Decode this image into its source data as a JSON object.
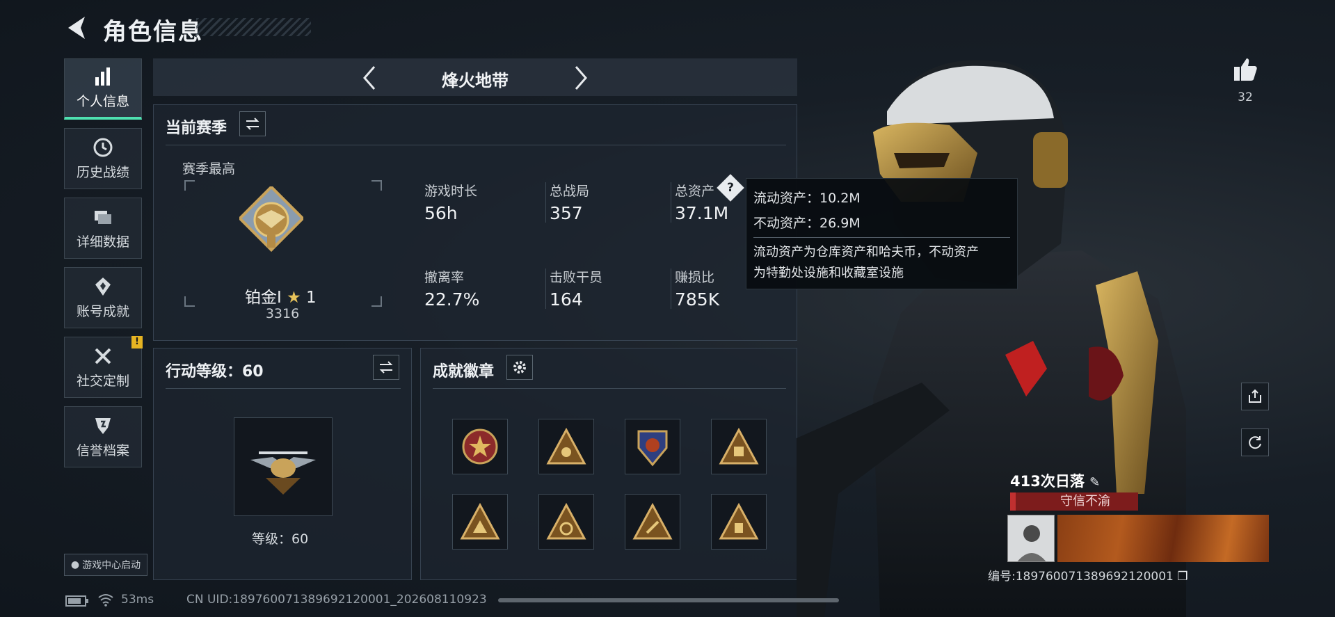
{
  "header": {
    "title": "角色信息"
  },
  "sidebar": {
    "items": [
      {
        "label": "个人信息",
        "icon": "bar-chart-icon",
        "active": true
      },
      {
        "label": "历史战绩",
        "icon": "clock-icon",
        "active": false
      },
      {
        "label": "详细数据",
        "icon": "folder-icon",
        "active": false
      },
      {
        "label": "账号成就",
        "icon": "medal-icon",
        "active": false
      },
      {
        "label": "社交定制",
        "icon": "tools-icon",
        "active": false,
        "badge": "!"
      },
      {
        "label": "信誉档案",
        "icon": "shield-icon",
        "active": false
      }
    ],
    "launch_label": "游戏中心启动"
  },
  "season_nav": {
    "title": "烽火地带"
  },
  "current_season": {
    "title": "当前赛季",
    "best_label": "赛季最高",
    "rank_name": "铂金Ⅰ",
    "rank_stars": "1",
    "rank_score": "3316",
    "stats": [
      {
        "label": "游戏时长",
        "value": "56h"
      },
      {
        "label": "总战局",
        "value": "357"
      },
      {
        "label": "总资产",
        "value": "37.1M"
      },
      {
        "label": "撤离率",
        "value": "22.7%"
      },
      {
        "label": "击败干员",
        "value": "164"
      },
      {
        "label": "赚损比",
        "value": "785K"
      }
    ]
  },
  "tooltip": {
    "liquid": "流动资产：10.2M",
    "fixed": "不动资产：26.9M",
    "desc_line1": "流动资产为仓库资产和哈夫币，不动资产",
    "desc_line2": "为特勤处设施和收藏室设施"
  },
  "action_level": {
    "title": "行动等级：60",
    "level_label": "等级：60"
  },
  "achievements": {
    "title": "成就徽章"
  },
  "profile_card": {
    "likes": "32",
    "name": "413次日落",
    "tag": "守信不渝",
    "id_text": "编号:189760071389692120001"
  },
  "footer": {
    "ping": "53ms",
    "uid": "CN UID:189760071389692120001_202608110923"
  },
  "colors": {
    "accent": "#4fe0b0",
    "warning": "#e6b422",
    "tag_red": "#7d1c1c"
  }
}
